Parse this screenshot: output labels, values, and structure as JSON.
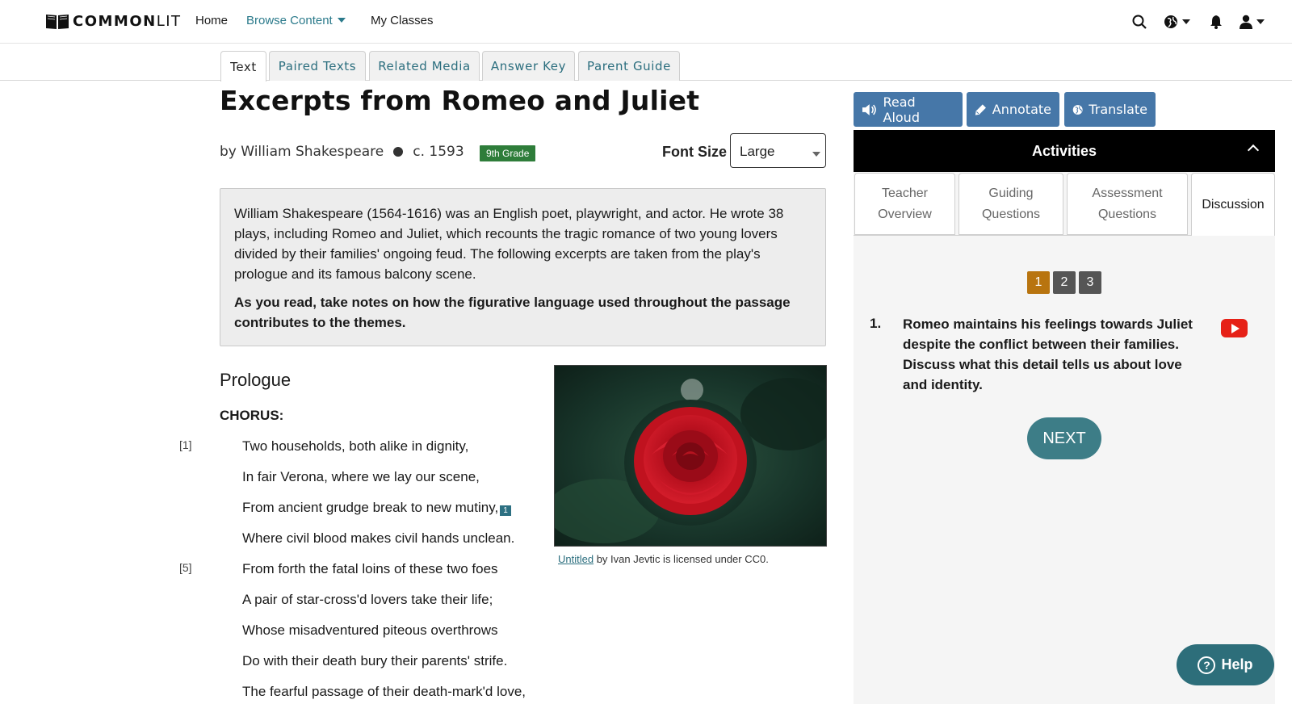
{
  "nav": {
    "logo_bold": "COMMON",
    "logo_light": "LIT",
    "home": "Home",
    "browse": "Browse Content",
    "classes": "My Classes"
  },
  "tabs": [
    "Text",
    "Paired Texts",
    "Related Media",
    "Answer Key",
    "Parent Guide"
  ],
  "text": {
    "title": "Excerpts from Romeo and Juliet",
    "author": "by William Shakespeare",
    "date": "c. 1593",
    "grade": "9th Grade",
    "font_size_label": "Font Size",
    "font_size_value": "Large",
    "intro": "William Shakespeare (1564-1616) was an English poet, playwright, and actor. He wrote 38 plays, including Romeo and Juliet, which recounts the tragic romance of two young lovers divided by their families' ongoing feud. The following excerpts are taken from the play's prologue and its famous balcony scene.",
    "intro_bold": "As you read, take notes on how the figurative language used throughout the passage contributes to the themes.",
    "section": "Prologue",
    "speaker": "CHORUS:",
    "lines": [
      "Two households, both alike in dignity,",
      "In fair Verona, where we lay our scene,",
      "From ancient grudge break to new mutiny,",
      "Where civil blood makes civil hands unclean.",
      "From forth the fatal loins of these two foes",
      "A pair of star-cross'd lovers take their life;",
      "Whose misadventured piteous overthrows",
      "Do with their death bury their parents' strife.",
      "The fearful passage of their death-mark'd love,"
    ],
    "line_numbers": [
      "[1]",
      "[5]"
    ],
    "footnote": "1",
    "caption_link": "Untitled",
    "caption_rest": " by Ivan Jevtic is licensed under CC0."
  },
  "tools": {
    "read_aloud": "Read Aloud",
    "annotate": "Annotate",
    "translate": "Translate"
  },
  "activities": {
    "header": "Activities",
    "tabs": [
      "Teacher Overview",
      "Guiding Questions",
      "Assessment Questions",
      "Discussion"
    ],
    "pages": [
      "1",
      "2",
      "3"
    ],
    "question_number": "1.",
    "question": "Romeo maintains his feelings towards Juliet despite the conflict between their families. Discuss what this detail tells us about love and identity.",
    "next": "NEXT"
  },
  "help": "Help",
  "colors": {
    "accent": "#2b7a8b",
    "tool_button": "#4677a8",
    "grade_badge": "#2e7d3a",
    "pager_active": "#b8740f",
    "pager_inactive": "#555555",
    "next_button": "#3d7d87",
    "youtube": "#e62117"
  }
}
